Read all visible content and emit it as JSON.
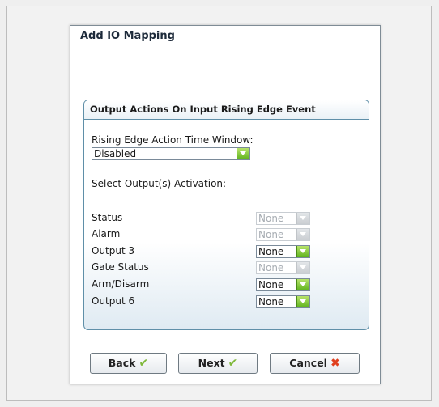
{
  "dialog": {
    "title": "Add IO Mapping"
  },
  "panel": {
    "header": "Output Actions On Input Rising Edge Event",
    "time_window_label": "Rising Edge Action Time Window:",
    "time_window_value": "Disabled",
    "activation_label": "Select Output(s) Activation:",
    "outputs": [
      {
        "label": "Status",
        "value": "None",
        "enabled": false
      },
      {
        "label": "Alarm",
        "value": "None",
        "enabled": false
      },
      {
        "label": "Output 3",
        "value": "None",
        "enabled": true
      },
      {
        "label": "Gate Status",
        "value": "None",
        "enabled": false
      },
      {
        "label": "Arm/Disarm",
        "value": "None",
        "enabled": true
      },
      {
        "label": "Output 6",
        "value": "None",
        "enabled": true
      }
    ]
  },
  "buttons": {
    "back": "Back",
    "next": "Next",
    "cancel": "Cancel"
  },
  "icons": {
    "back": "check-icon",
    "next": "check-icon",
    "cancel": "cross-icon",
    "dropdown": "chevron-down-icon"
  },
  "colors": {
    "accent_green": "#5fb31d",
    "cancel_red": "#e0401f",
    "panel_border": "#5f8fa8"
  }
}
